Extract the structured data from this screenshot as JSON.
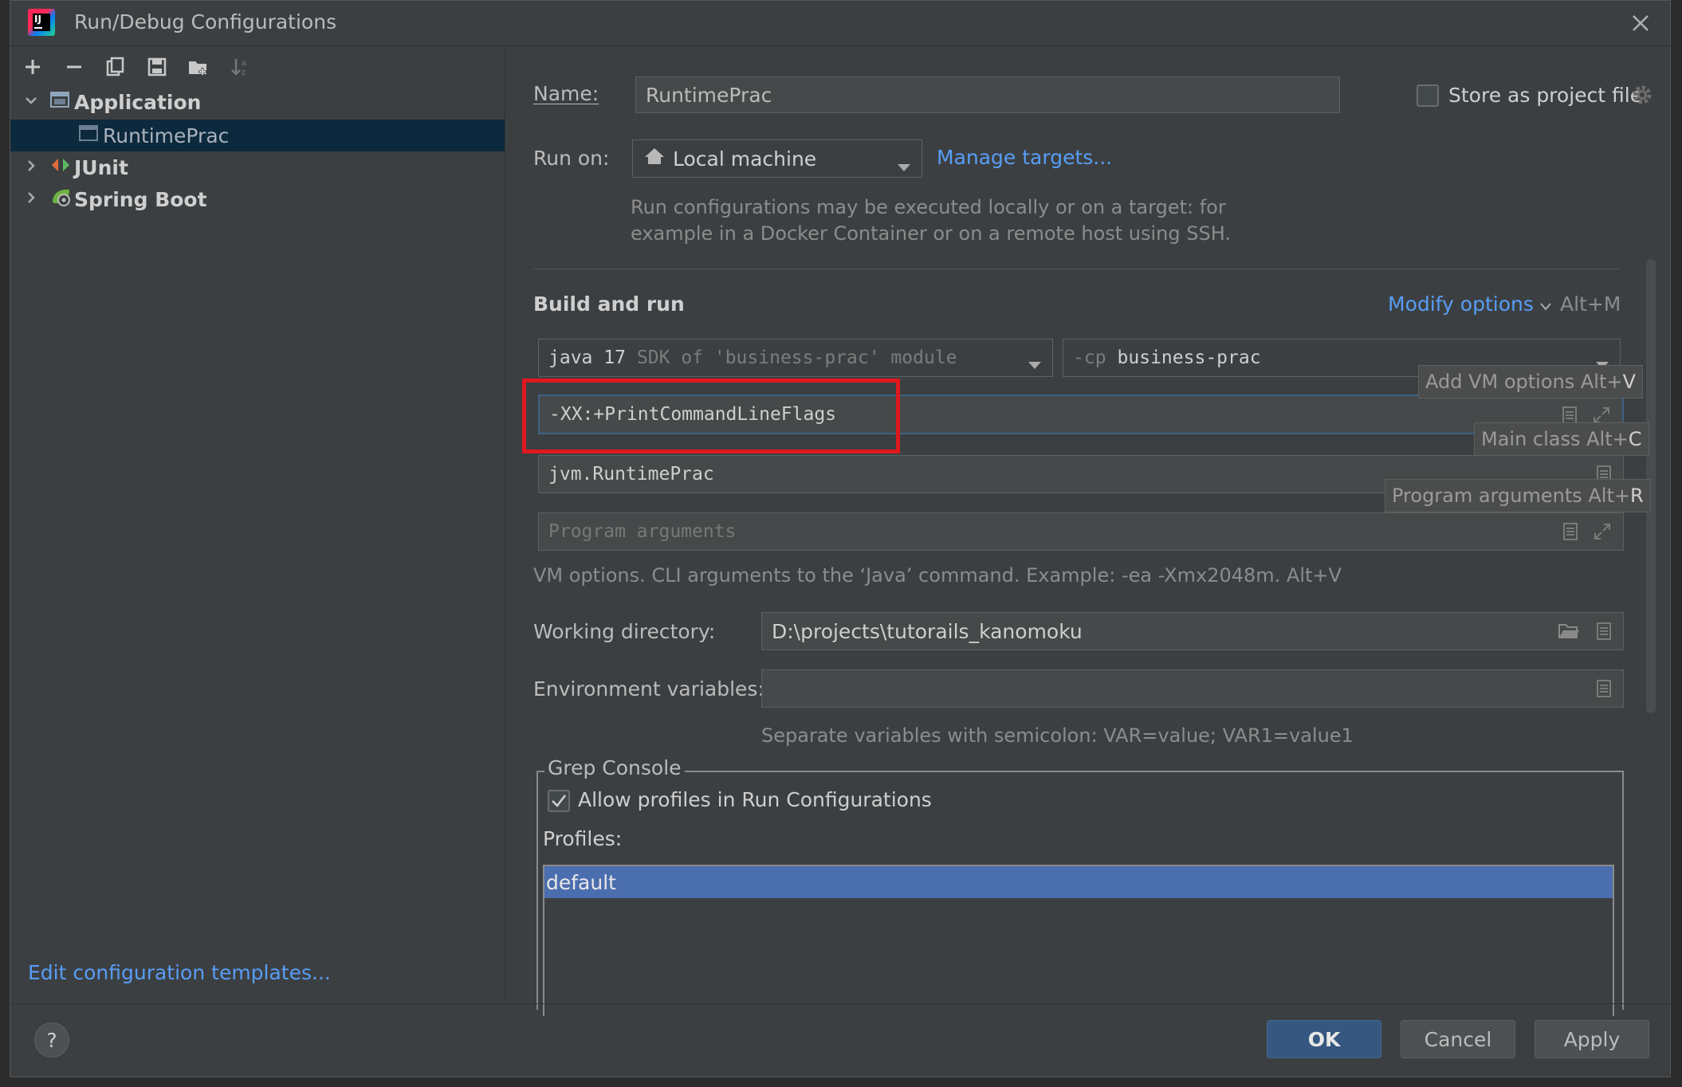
{
  "dialog": {
    "title": "Run/Debug Configurations"
  },
  "toolbar": {
    "add": "+",
    "remove": "−"
  },
  "tree": {
    "items": [
      {
        "label": "Application",
        "expanded": true
      },
      {
        "label": "RuntimePrac",
        "selected": true
      },
      {
        "label": "JUnit",
        "expanded": false
      },
      {
        "label": "Spring Boot",
        "expanded": false
      }
    ],
    "edit_templates_link": "Edit configuration templates..."
  },
  "form": {
    "name_label": "Name:",
    "name_value": "RuntimePrac",
    "store_label": "Store as project file",
    "store_checked": false,
    "run_on_label": "Run on:",
    "run_on_value": "Local machine",
    "manage_targets_link": "Manage targets...",
    "run_on_hint_line1": "Run configurations may be executed locally or on a target: for",
    "run_on_hint_line2": "example in a Docker Container or on a remote host using SSH.",
    "build_run_heading": "Build and run",
    "modify_options_link": "Modify options",
    "modify_options_shortcut": "Alt+M",
    "jdk_main": "java 17",
    "jdk_detail": "SDK of 'business-prac' module",
    "cp_prefix": "-cp",
    "cp_value": "business-prac",
    "vm_options_value": "-XX:+PrintCommandLineFlags",
    "main_class_value": "jvm.RuntimePrac",
    "program_args_placeholder": "Program arguments",
    "vm_hint": "VM options. CLI arguments to the ‘Java’ command. Example: -ea -Xmx2048m. Alt+V",
    "working_dir_label": "Working directory:",
    "working_dir_value": "D:\\projects\\tutorails_kanomoku",
    "env_label": "Environment variables:",
    "env_value": "",
    "env_hint": "Separate variables with semicolon: VAR=value; VAR1=value1",
    "grep_console_title": "Grep Console",
    "allow_profiles_label": "Allow profiles in Run Configurations",
    "allow_profiles_checked": true,
    "profiles_label": "Profiles:",
    "profiles": [
      "default"
    ]
  },
  "tooltips": {
    "vm_text": "Add VM options Alt+",
    "vm_key": "V",
    "main_text": "Main class Alt+",
    "main_key": "C",
    "args_text": "Program arguments Alt+",
    "args_key": "R"
  },
  "footer": {
    "help": "?",
    "ok": "OK",
    "cancel": "Cancel",
    "apply": "Apply"
  },
  "colors": {
    "accent": "#589df6",
    "selection": "#4b6eaf",
    "highlight_box": "#e0171f",
    "tree_selection": "#0d293e"
  }
}
